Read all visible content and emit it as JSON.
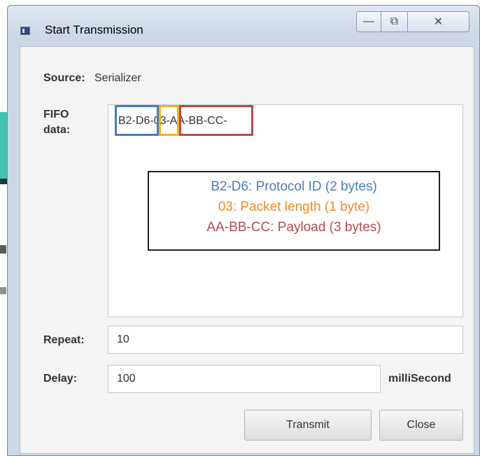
{
  "window": {
    "title": "Start Transmission",
    "controls": {
      "minimize": "—",
      "maximize": "⧉",
      "close": "✕"
    }
  },
  "form": {
    "source_label": "Source:",
    "source_value": "Serializer",
    "fifo_label_line1": "FIFO",
    "fifo_label_line2": "data:",
    "fifo_value": "B2-D6-03-AA-BB-CC-",
    "repeat_label": "Repeat:",
    "repeat_value": "10",
    "delay_label": "Delay:",
    "delay_value": "100",
    "delay_unit": "milliSecond"
  },
  "annotation": {
    "protocol_line": "B2-D6: Protocol ID (2 bytes)",
    "length_line": "03: Packet length (1 byte)",
    "payload_line": "AA-BB-CC: Payload (3 bytes)",
    "colors": {
      "protocol": "#4a7bb8",
      "length": "#f2b21f",
      "payload": "#b8494c"
    }
  },
  "buttons": {
    "transmit": "Transmit",
    "close": "Close"
  }
}
